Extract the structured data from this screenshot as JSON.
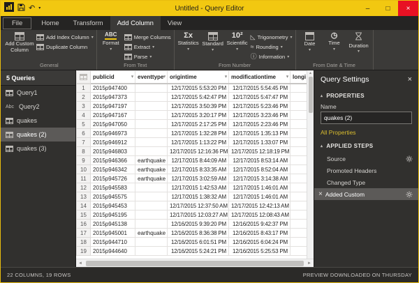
{
  "colors": {
    "accent": "#f2c811",
    "close_red": "#e81123",
    "link": "#d9bc2e"
  },
  "glyphs": {
    "caret": "▾",
    "tri_up": "▴",
    "undo": "↶",
    "close": "×",
    "minimize": "–",
    "maximize": "□",
    "sigma": "Σx",
    "scientific": "10²",
    "abc": "ABC",
    "abc_small": "Abc",
    "clock": "◷",
    "triangle": "◺",
    "rounding": "≈",
    "information": "ⓘ",
    "scroll_left": "◄",
    "scroll_right": "►",
    "scroll_up": "▲",
    "scroll_down": "▼"
  },
  "window": {
    "title": "Untitled - Query Editor"
  },
  "ribbon": {
    "tabs": [
      {
        "label": "File"
      },
      {
        "label": "Home"
      },
      {
        "label": "Transform"
      },
      {
        "label": "Add Column",
        "selected": true
      },
      {
        "label": "View"
      }
    ],
    "groups": [
      {
        "label": "General",
        "big": [
          {
            "label": "Add Custom Column"
          }
        ],
        "small": [
          {
            "label": "Add Index Column",
            "dropdown": true
          },
          {
            "label": "Duplicate Column",
            "dropdown": false
          }
        ]
      },
      {
        "label": "From Text",
        "big": [
          {
            "label": "Format",
            "dropdown": true
          }
        ],
        "small": [
          {
            "label": "Merge Columns",
            "dropdown": false
          },
          {
            "label": "Extract",
            "dropdown": true
          },
          {
            "label": "Parse",
            "dropdown": true
          }
        ]
      },
      {
        "label": "From Number",
        "big": [
          {
            "label": "Statistics",
            "dropdown": true
          },
          {
            "label": "Standard",
            "dropdown": true
          },
          {
            "label": "Scientific",
            "dropdown": true
          }
        ],
        "small": [
          {
            "label": "Trigonometry",
            "dropdown": true
          },
          {
            "label": "Rounding",
            "dropdown": true
          },
          {
            "label": "Information",
            "dropdown": true
          }
        ]
      },
      {
        "label": "From Date & Time",
        "big": [
          {
            "label": "Date",
            "dropdown": true
          },
          {
            "label": "Time",
            "dropdown": true
          },
          {
            "label": "Duration",
            "dropdown": true
          }
        ],
        "small": []
      }
    ]
  },
  "queries": {
    "header": "5 Queries",
    "items": [
      {
        "label": "Query1",
        "icon": "table"
      },
      {
        "label": "Query2",
        "icon": "abc"
      },
      {
        "label": "quakes",
        "icon": "table"
      },
      {
        "label": "quakes (2)",
        "icon": "table",
        "selected": true
      },
      {
        "label": "quakes (3)",
        "icon": "table"
      }
    ]
  },
  "grid": {
    "columns": [
      {
        "label": "publicid"
      },
      {
        "label": "eventtype"
      },
      {
        "label": "origintime"
      },
      {
        "label": "modificationtime"
      },
      {
        "label": "longi"
      }
    ],
    "rows": [
      [
        "2015p947400",
        "",
        "12/17/2015 5:53:20 PM",
        "12/17/2015 5:54:45 PM",
        ""
      ],
      [
        "2015p947373",
        "",
        "12/17/2015 5:42:47 PM",
        "12/17/2015 5:47:47 PM",
        ""
      ],
      [
        "2015p947197",
        "",
        "12/17/2015 3:50:39 PM",
        "12/17/2015 5:23:46 PM",
        ""
      ],
      [
        "2015p947167",
        "",
        "12/17/2015 3:20:17 PM",
        "12/17/2015 3:23:46 PM",
        ""
      ],
      [
        "2015p947050",
        "",
        "12/17/2015 2:17:25 PM",
        "12/17/2015 2:23:46 PM",
        ""
      ],
      [
        "2015p946973",
        "",
        "12/17/2015 1:32:28 PM",
        "12/17/2015 1:35:13 PM",
        ""
      ],
      [
        "2015p946912",
        "",
        "12/17/2015 1:13:22 PM",
        "12/17/2015 1:33:07 PM",
        ""
      ],
      [
        "2015p946803",
        "",
        "12/17/2015 12:16:36 PM",
        "12/17/2015 12:18:19 PM",
        ""
      ],
      [
        "2015p946366",
        "earthquake",
        "12/17/2015 8:44:09 AM",
        "12/17/2015 8:53:14 AM",
        ""
      ],
      [
        "2015p946342",
        "earthquake",
        "12/17/2015 8:33:35 AM",
        "12/17/2015 8:52:04 AM",
        ""
      ],
      [
        "2015p945726",
        "earthquake",
        "12/17/2015 3:02:59 AM",
        "12/17/2015 3:14:38 AM",
        ""
      ],
      [
        "2015p945583",
        "",
        "12/17/2015 1:42:53 AM",
        "12/17/2015 1:46:01 AM",
        ""
      ],
      [
        "2015p945575",
        "",
        "12/17/2015 1:38:32 AM",
        "12/17/2015 1:46:01 AM",
        ""
      ],
      [
        "2015p945453",
        "",
        "12/17/2015 12:37:50 AM",
        "12/17/2015 12:42:13 AM",
        ""
      ],
      [
        "2015p945195",
        "",
        "12/17/2015 12:03:27 AM",
        "12/17/2015 12:08:43 AM",
        ""
      ],
      [
        "2015p945138",
        "",
        "12/16/2015 9:39:20 PM",
        "12/16/2015 9:42:37 PM",
        ""
      ],
      [
        "2015p945001",
        "earthquake",
        "12/16/2015 8:36:38 PM",
        "12/16/2015 8:43:17 PM",
        ""
      ],
      [
        "2015p944710",
        "",
        "12/16/2015 6:01:51 PM",
        "12/16/2015 6:04:24 PM",
        ""
      ],
      [
        "2015p944640",
        "",
        "12/16/2015 5:24:21 PM",
        "12/16/2015 5:25:53 PM",
        ""
      ]
    ]
  },
  "settings": {
    "title": "Query Settings",
    "properties": {
      "heading": "PROPERTIES",
      "name_label": "Name",
      "name_value": "quakes (2)",
      "all_properties": "All Properties"
    },
    "applied_steps": {
      "heading": "APPLIED STEPS",
      "items": [
        {
          "label": "Source",
          "gear": true
        },
        {
          "label": "Promoted Headers"
        },
        {
          "label": "Changed Type"
        },
        {
          "label": "Added Custom",
          "selected": true,
          "gear": true,
          "delete": true
        }
      ]
    }
  },
  "statusbar": {
    "left": "22 COLUMNS, 19 ROWS",
    "right": "PREVIEW DOWNLOADED ON THURSDAY"
  }
}
